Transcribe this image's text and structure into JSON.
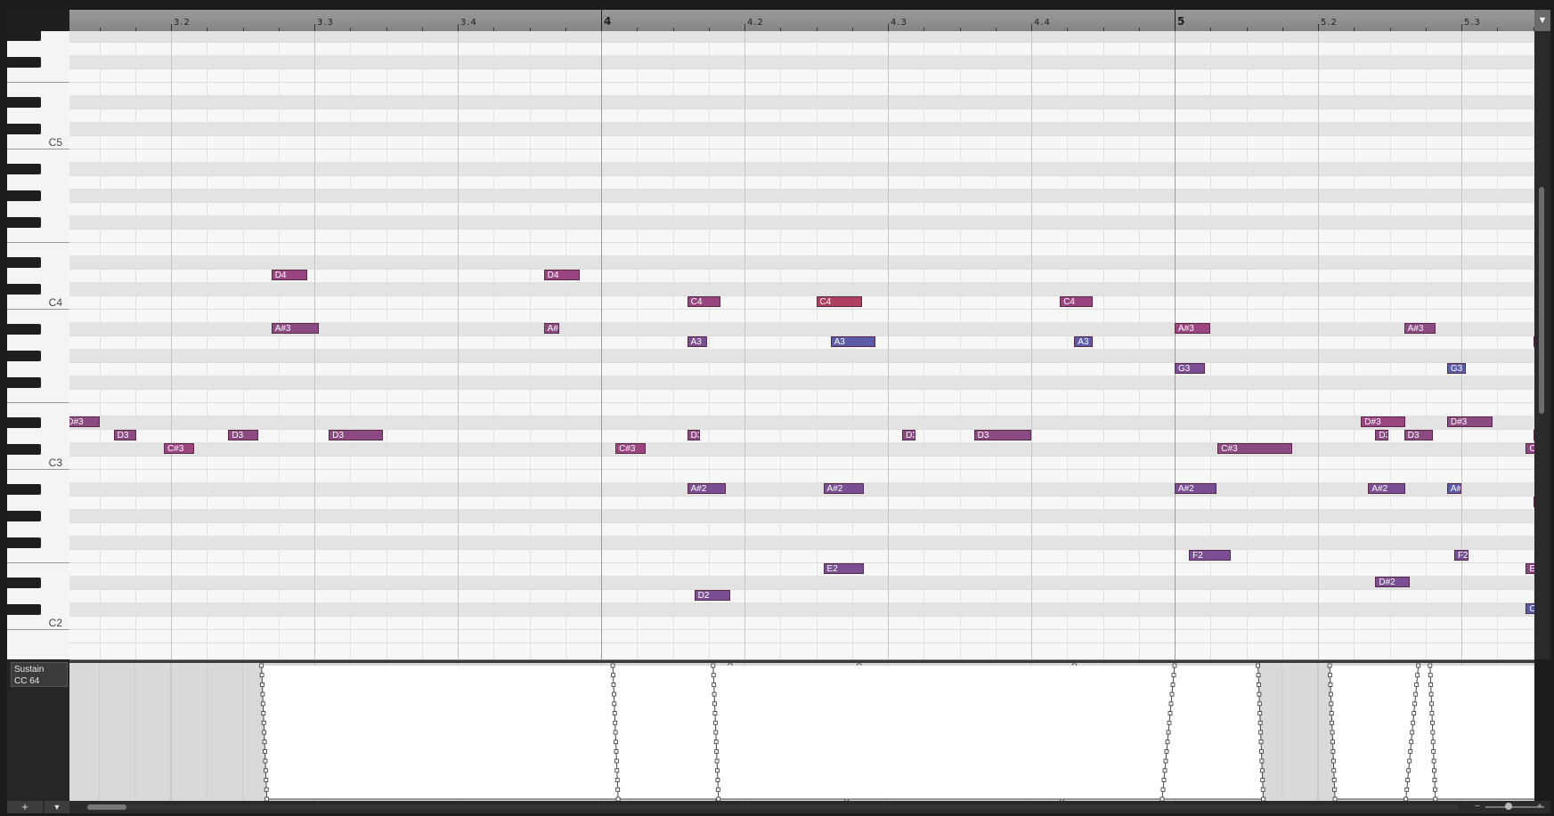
{
  "ruler": {
    "labels": [
      {
        "text": "3.2",
        "bar": 3,
        "beat": 2,
        "major": false
      },
      {
        "text": "3.3",
        "bar": 3,
        "beat": 3,
        "major": false
      },
      {
        "text": "3.4",
        "bar": 3,
        "beat": 4,
        "major": false
      },
      {
        "text": "4",
        "bar": 4,
        "beat": 1,
        "major": true
      },
      {
        "text": "4.2",
        "bar": 4,
        "beat": 2,
        "major": false
      },
      {
        "text": "4.3",
        "bar": 4,
        "beat": 3,
        "major": false
      },
      {
        "text": "4.4",
        "bar": 4,
        "beat": 4,
        "major": false
      },
      {
        "text": "5",
        "bar": 5,
        "beat": 1,
        "major": true
      },
      {
        "text": "5.2",
        "bar": 5,
        "beat": 2,
        "major": false
      },
      {
        "text": "5.3",
        "bar": 5,
        "beat": 3,
        "major": false
      }
    ]
  },
  "keyboard": {
    "labels": [
      "C5",
      "C4",
      "C3",
      "C2"
    ]
  },
  "notes": [
    {
      "label": "D4",
      "pitch": "D4",
      "start": 3.17,
      "len": 0.25,
      "color": "#9a4580"
    },
    {
      "label": "D4",
      "pitch": "D4",
      "start": 3.36,
      "len": 0.25,
      "color": "#9a4580"
    },
    {
      "label": "C4",
      "pitch": "C4",
      "start": 3.46,
      "len": 0.23,
      "color": "#9a4580"
    },
    {
      "label": "C4",
      "pitch": "C4",
      "start": 4.15,
      "len": 0.32,
      "color": "#b0405f"
    },
    {
      "label": "C4",
      "pitch": "C4",
      "start": 4.32,
      "len": 0.23,
      "color": "#9a4580"
    },
    {
      "label": "A#3",
      "pitch": "A#3",
      "start": 3.17,
      "len": 0.33,
      "color": "#8c4a82"
    },
    {
      "label": "A#",
      "pitch": "A#3",
      "start": 3.36,
      "len": 0.11,
      "color": "#8c4a82"
    },
    {
      "label": "A#3",
      "pitch": "A#3",
      "start": 4.4,
      "len": 0.25,
      "color": "#9a4580"
    },
    {
      "label": "A#3",
      "pitch": "A#3",
      "start": 4.96,
      "len": 0.39,
      "color": "#8c4a82"
    },
    {
      "label": "A#3",
      "pitch": "A#3",
      "start": 5.16,
      "len": 0.22,
      "color": "#8c4a82"
    },
    {
      "label": "A3",
      "pitch": "A3",
      "start": 3.46,
      "len": 0.14,
      "color": "#7a4e93"
    },
    {
      "label": "A3",
      "pitch": "A3",
      "start": 4.16,
      "len": 0.31,
      "color": "#5b5ba8"
    },
    {
      "label": "A3",
      "pitch": "A3",
      "start": 4.33,
      "len": 0.13,
      "color": "#5b5ba8"
    },
    {
      "label": "A3",
      "pitch": "A3",
      "start": 5.25,
      "len": 0.12,
      "color": "#9a4580"
    },
    {
      "label": "G3",
      "pitch": "G3",
      "start": 4.4,
      "len": 0.21,
      "color": "#7a4e93"
    },
    {
      "label": "G3",
      "pitch": "G3",
      "start": 4.97,
      "len": 0.28,
      "color": "#7a4e93"
    },
    {
      "label": "G3",
      "pitch": "G3",
      "start": 5.19,
      "len": 0.13,
      "color": "#5b5ba8"
    },
    {
      "label": "F#3",
      "pitch": "F#3",
      "start": 5.44,
      "len": 0.14,
      "color": "#b0405f"
    },
    {
      "label": "E3",
      "pitch": "E3",
      "start": 5.4,
      "len": 0.12,
      "color": "#8c4a82"
    },
    {
      "label": "D#3",
      "pitch": "D#3",
      "start": 3.025,
      "len": 0.25,
      "color": "#8c4a82"
    },
    {
      "label": "D#3",
      "pitch": "D#3",
      "start": 3.93,
      "len": 0.31,
      "color": "#9a4580"
    },
    {
      "label": "D#3",
      "pitch": "D#3",
      "start": 4.59,
      "len": 0.32,
      "color": "#8c4a82"
    },
    {
      "label": "D#",
      "pitch": "D#3",
      "start": 5.36,
      "len": 0.11,
      "color": "#7a4e93"
    },
    {
      "label": "D3",
      "pitch": "D3",
      "start": 3.06,
      "len": 0.16,
      "color": "#8c4a82"
    },
    {
      "label": "D3",
      "pitch": "D3",
      "start": 3.14,
      "len": 0.21,
      "color": "#8c4a82"
    },
    {
      "label": "D3",
      "pitch": "D3",
      "start": 3.21,
      "len": 0.38,
      "color": "#8c4a82"
    },
    {
      "label": "D3",
      "pitch": "D3",
      "start": 3.61,
      "len": 0.09,
      "color": "#8c4a82"
    },
    {
      "label": "D3",
      "pitch": "D3",
      "start": 3.96,
      "len": 0.2,
      "color": "#8c4a82"
    },
    {
      "label": "D3",
      "pitch": "D3",
      "start": 4.06,
      "len": 0.09,
      "color": "#8c4a82"
    },
    {
      "label": "D3",
      "pitch": "D3",
      "start": 4.26,
      "len": 0.4,
      "color": "#8c4a82"
    },
    {
      "label": "D3",
      "pitch": "D3",
      "start": 4.54,
      "len": 0.09,
      "color": "#8c4a82"
    },
    {
      "label": "D3",
      "pitch": "D3",
      "start": 4.65,
      "len": 0.18,
      "color": "#7a4e93"
    },
    {
      "label": "D3",
      "pitch": "D3",
      "start": 4.76,
      "len": 0.16,
      "color": "#8c4a82"
    },
    {
      "label": "C#3",
      "pitch": "C#3",
      "start": 3.095,
      "len": 0.21,
      "color": "#9a4580"
    },
    {
      "label": "C#3",
      "pitch": "C#3",
      "start": 4.01,
      "len": 0.21,
      "color": "#9a4580"
    },
    {
      "label": "C#3",
      "pitch": "C#3",
      "start": 4.67,
      "len": 0.2,
      "color": "#9a4580"
    },
    {
      "label": "C#3",
      "pitch": "C#3",
      "start": 5.03,
      "len": 0.52,
      "color": "#8c4a82"
    },
    {
      "label": "C#",
      "pitch": "C#3",
      "start": 5.245,
      "len": 0.1,
      "color": "#8c4a82"
    },
    {
      "label": "A#2",
      "pitch": "A#2",
      "start": 3.46,
      "len": 0.27,
      "color": "#7a4e93"
    },
    {
      "label": "A#2",
      "pitch": "A#2",
      "start": 3.935,
      "len": 0.26,
      "color": "#7a4e93"
    },
    {
      "label": "A#2",
      "pitch": "A#2",
      "start": 4.155,
      "len": 0.28,
      "color": "#7a4e93"
    },
    {
      "label": "A#2",
      "pitch": "A#2",
      "start": 4.4,
      "len": 0.29,
      "color": "#7a4e93"
    },
    {
      "label": "A#",
      "pitch": "A#2",
      "start": 4.59,
      "len": 0.1,
      "color": "#5b5ba8"
    },
    {
      "label": "A2",
      "pitch": "A2",
      "start": 5.25,
      "len": 0.13,
      "color": "#5b5ba8"
    },
    {
      "label": "A2",
      "pitch": "A2",
      "start": 5.44,
      "len": 0.14,
      "color": "#5b5ba8"
    },
    {
      "label": "F2",
      "pitch": "F2",
      "start": 4.41,
      "len": 0.29,
      "color": "#7a4e93"
    },
    {
      "label": "F2",
      "pitch": "F2",
      "start": 4.595,
      "len": 0.1,
      "color": "#7a4e93"
    },
    {
      "label": "E2",
      "pitch": "E2",
      "start": 4.155,
      "len": 0.28,
      "color": "#7a4e93"
    },
    {
      "label": "E2",
      "pitch": "E2",
      "start": 5.245,
      "len": 0.11,
      "color": "#8c4a82"
    },
    {
      "label": "E2",
      "pitch": "E2",
      "start": 5.44,
      "len": 0.14,
      "color": "#8c4a82"
    },
    {
      "label": "D#2",
      "pitch": "D#2",
      "start": 3.94,
      "len": 0.24,
      "color": "#7a4e93"
    },
    {
      "label": "D2",
      "pitch": "D2",
      "start": 3.465,
      "len": 0.25,
      "color": "#7a4e93"
    },
    {
      "label": "C#2",
      "pitch": "C#2",
      "start": 5.245,
      "len": 0.14,
      "color": "#5b5ba8"
    },
    {
      "label": "C#2",
      "pitch": "C#2",
      "start": 5.44,
      "len": 0.14,
      "color": "#5b5ba8"
    }
  ],
  "controller_lane": {
    "name": "Sustain",
    "cc": "CC 64",
    "pedal_segments": [
      {
        "down": 3.165,
        "up": 3.49
      },
      {
        "down": 3.41,
        "up": 3.73
      },
      {
        "down": 3.86,
        "up": 4.18
      },
      {
        "down": 4.08,
        "up": 4.4
      },
      {
        "down": 4.51,
        "up": 4.83
      },
      {
        "down": 4.95,
        "up": 5.17
      },
      {
        "down": 5.18,
        "up": 5.51
      },
      {
        "down": 5.52,
        "up": 5.6
      }
    ]
  },
  "footer": {
    "add_lane_icon": "plus-icon",
    "add_lane_glyph": "+",
    "lane_menu_icon": "triangle-down-icon",
    "lane_menu_glyph": "▼",
    "scroll_up_glyph": "▼",
    "zoom_minus": "−",
    "zoom_plus": "+"
  }
}
